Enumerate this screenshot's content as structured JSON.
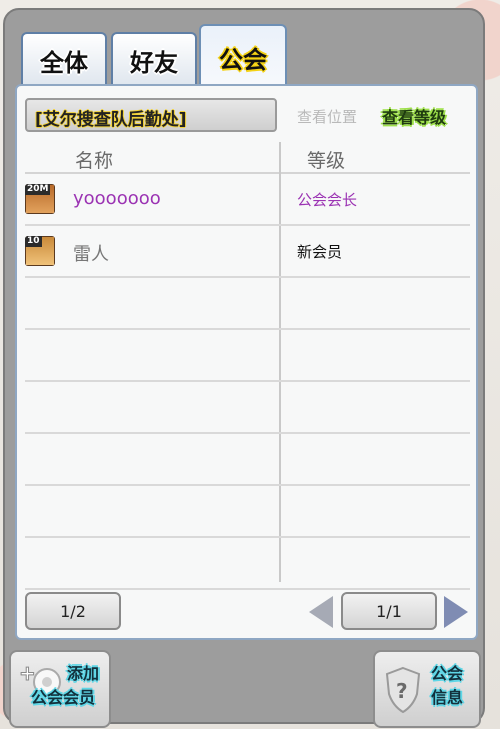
{
  "tabs": [
    {
      "label": "全体",
      "active": false
    },
    {
      "label": "好友",
      "active": false
    },
    {
      "label": "公会",
      "active": true
    }
  ],
  "location": {
    "current": "[艾尔搜查队后勤处]",
    "view_location_label": "查看位置",
    "view_level_label": "查看等级"
  },
  "table": {
    "headers": {
      "name": "名称",
      "level": "等级"
    },
    "rows": [
      {
        "badge": "20M",
        "name": "yooooooo",
        "rank": "公会会长",
        "name_color": "#9b33b3",
        "rank_color": "#9b33b3"
      },
      {
        "badge": "10",
        "name": "雷人",
        "rank": "新会员",
        "name_color": "#777777",
        "rank_color": "#111111"
      }
    ]
  },
  "pager": {
    "left_label": "1/2",
    "right_label": "1/1"
  },
  "bottom": {
    "add_member_label_1": "添加",
    "add_member_label_2": "公会会员",
    "guild_info_label_1": "公会",
    "guild_info_label_2": "信息"
  },
  "icons": {
    "prev": "triangle-left-icon",
    "next": "triangle-right-icon",
    "add_member": "add-member-icon",
    "guild_info": "shield-question-icon"
  }
}
